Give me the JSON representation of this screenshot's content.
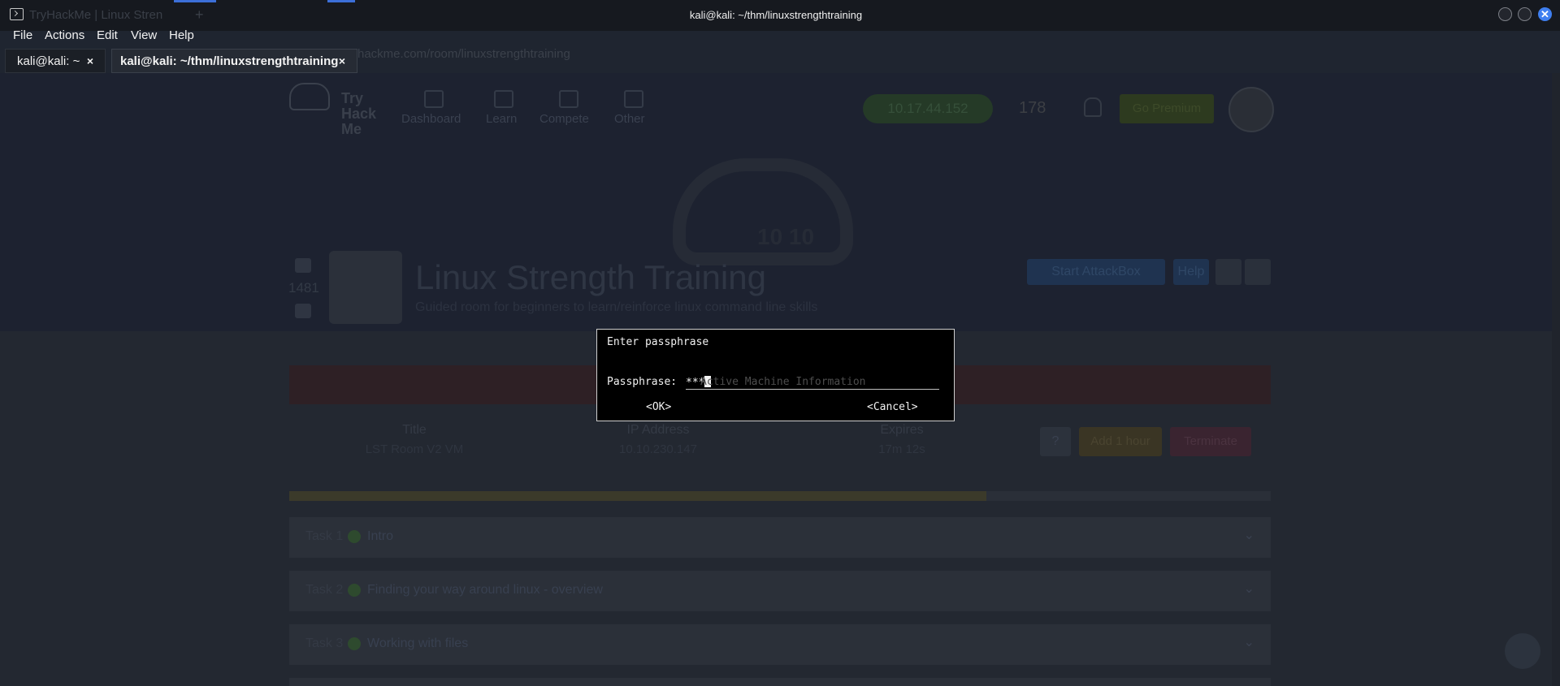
{
  "window": {
    "title": "kali@kali: ~/thm/linuxstrengthtraining",
    "ghost_browser_tab": "TryHackMe | Linux Stren",
    "close_glyph": "✕"
  },
  "menu": [
    "File",
    "Actions",
    "Edit",
    "View",
    "Help"
  ],
  "tabs": [
    {
      "label": "kali@kali: ~",
      "close": "×"
    },
    {
      "label": "kali@kali: ~/thm/linuxstrengthtraining",
      "close": "×"
    }
  ],
  "background_page": {
    "url_hint": "hackme.com/room/linuxstrengthtraining",
    "logo": "Try Hack Me",
    "nav": [
      "Dashboard",
      "Learn",
      "Compete",
      "Other"
    ],
    "ip": "10.17.44.152",
    "streak": "178",
    "go_premium": "Go Premium",
    "cloud_numbers": "10 10",
    "votes": "1481",
    "room_title": "Linux Strength Training",
    "room_subtitle": "Guided room for beginners to learn/reinforce linux command line skills",
    "start_attackbox": "Start AttackBox",
    "help": "Help",
    "banner": "Active Machine Information",
    "info": {
      "title_label": "Title",
      "title_value": "LST Room V2 VM",
      "ip_label": "IP Address",
      "ip_value": "10.10.230.147",
      "expires_label": "Expires",
      "expires_value": "17m 12s"
    },
    "question_mark": "?",
    "add_hour": "Add 1 hour",
    "terminate": "Terminate",
    "progress_fraction": 0.71,
    "tasks": [
      {
        "label": "Task 1",
        "title": "Intro"
      },
      {
        "label": "Task 2",
        "title": "Finding your way around linux - overview"
      },
      {
        "label": "Task 3",
        "title": "Working with files"
      }
    ],
    "chevron": "⌄"
  },
  "dialog": {
    "prompt": "Enter passphrase",
    "label": "Passphrase:",
    "value": "***",
    "ok": "<OK>",
    "cancel": "<Cancel>"
  }
}
